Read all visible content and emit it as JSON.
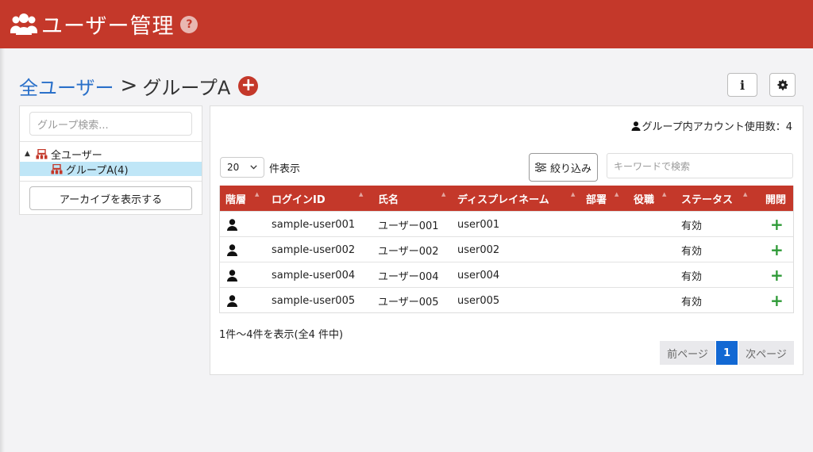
{
  "header": {
    "title": "ユーザー管理",
    "help": "?",
    "icon": "users-icon",
    "color": "#c4382a"
  },
  "breadcrumb": {
    "root": "全ユーザー",
    "separator": ">",
    "current": "グループA",
    "add": "+"
  },
  "toolbar": {
    "info": "i",
    "settings_icon": "gear-icon"
  },
  "sidebar": {
    "search_placeholder": "グループ検索...",
    "tree": [
      {
        "label": "全ユーザー",
        "caret": "▲"
      },
      {
        "label": "グループA(4)"
      }
    ],
    "archive_button": "アーカイブを表示する"
  },
  "panel": {
    "usage_label": "グループ内アカウント使用数：4",
    "page_length": "20",
    "page_length_suffix": "件表示",
    "filter_button": "絞り込み",
    "keyword_placeholder": "キーワードで検索",
    "columns": [
      "階層",
      "ログインID",
      "氏名",
      "ディスプレイネーム",
      "部署",
      "役職",
      "ステータス",
      "開閉"
    ],
    "rows": [
      {
        "login_id": "sample-user001",
        "name": "ユーザー001",
        "display": "user001",
        "dept": "",
        "title": "",
        "status": "有効",
        "toggle": "+"
      },
      {
        "login_id": "sample-user002",
        "name": "ユーザー002",
        "display": "user002",
        "dept": "",
        "title": "",
        "status": "有効",
        "toggle": "+"
      },
      {
        "login_id": "sample-user004",
        "name": "ユーザー004",
        "display": "user004",
        "dept": "",
        "title": "",
        "status": "有効",
        "toggle": "+"
      },
      {
        "login_id": "sample-user005",
        "name": "ユーザー005",
        "display": "user005",
        "dept": "",
        "title": "",
        "status": "有効",
        "toggle": "+"
      }
    ],
    "info": "1件～4件を表示(全4 件中)",
    "pagination": {
      "prev": "前ページ",
      "current": "1",
      "next": "次ページ"
    }
  }
}
